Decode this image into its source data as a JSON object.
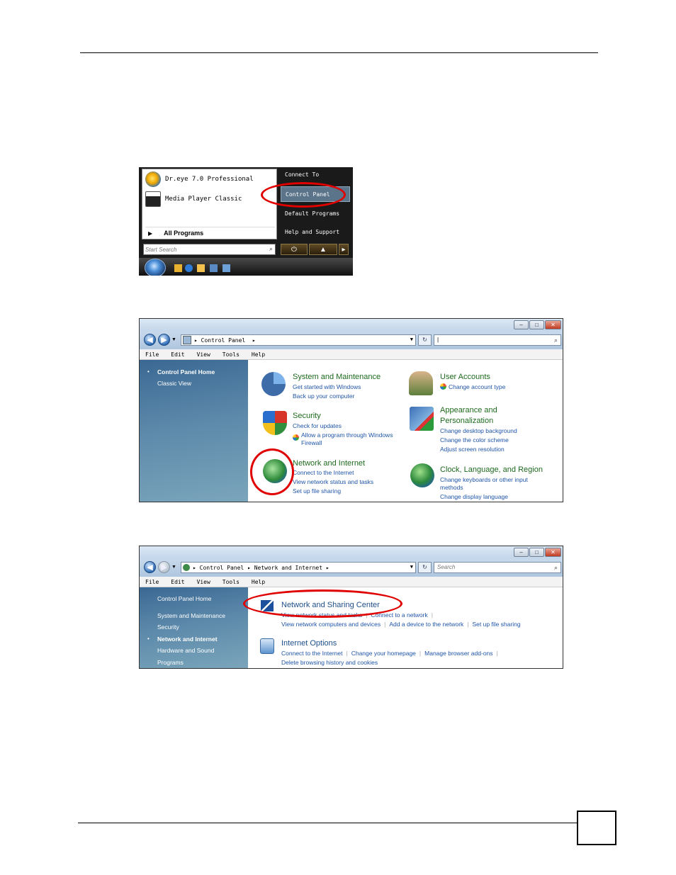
{
  "start_menu": {
    "programs": [
      "Dr.eye 7.0 Professional",
      "Media Player Classic"
    ],
    "all_programs": "All Programs",
    "search_placeholder": "Start Search",
    "right_items": [
      "Connect To",
      "Control Panel",
      "Default Programs",
      "Help and Support"
    ],
    "selected_item": "Control Panel"
  },
  "window1": {
    "address": [
      "Control Panel"
    ],
    "search_value": "",
    "menu": [
      "File",
      "Edit",
      "View",
      "Tools",
      "Help"
    ],
    "left_nav": [
      {
        "label": "Control Panel Home",
        "current": true
      },
      {
        "label": "Classic View",
        "current": false
      }
    ],
    "categories": {
      "system": {
        "title": "System and Maintenance",
        "links": [
          "Get started with Windows",
          "Back up your computer"
        ]
      },
      "user": {
        "title": "User Accounts",
        "links": [
          "Change account type"
        ]
      },
      "security": {
        "title": "Security",
        "links": [
          "Check for updates",
          "Allow a program through Windows",
          "Firewall"
        ]
      },
      "appearance": {
        "title_lines": [
          "Appearance and",
          "Personalization"
        ],
        "links": [
          "Change desktop background",
          "Change the color scheme",
          "Adjust screen resolution"
        ]
      },
      "network": {
        "title": "Network and Internet",
        "links": [
          "Connect to the Internet",
          "View network status and tasks",
          "Set up file sharing"
        ]
      },
      "clock": {
        "title": "Clock, Language, and Region",
        "links": [
          "Change keyboards or other input",
          "methods",
          "Change display language"
        ]
      }
    }
  },
  "window2": {
    "address": [
      "Control Panel",
      "Network and Internet"
    ],
    "search_placeholder": "Search",
    "menu": [
      "File",
      "Edit",
      "View",
      "Tools",
      "Help"
    ],
    "left_nav": [
      {
        "label": "Control Panel Home",
        "current": false
      },
      {
        "label": "System and Maintenance",
        "current": false
      },
      {
        "label": "Security",
        "current": false
      },
      {
        "label": "Network and Internet",
        "current": true
      },
      {
        "label": "Hardware and Sound",
        "current": false
      },
      {
        "label": "Programs",
        "current": false
      }
    ],
    "sections": {
      "nsc": {
        "title": "Network and Sharing Center",
        "row1": [
          "View network status and tasks",
          "Connect to a network"
        ],
        "row2": [
          "View network computers and devices",
          "Add a device to the network",
          "Set up file sharing"
        ]
      },
      "inet": {
        "title": "Internet Options",
        "row1": [
          "Connect to the Internet",
          "Change your homepage",
          "Manage browser add-ons"
        ],
        "row2": [
          "Delete browsing history and cookies"
        ]
      }
    }
  },
  "colors": {
    "highlight_ring": "#e00000",
    "category_title": "#1e6a1e",
    "link": "#1f55a8",
    "nav_pane": "#4f7fa3"
  }
}
